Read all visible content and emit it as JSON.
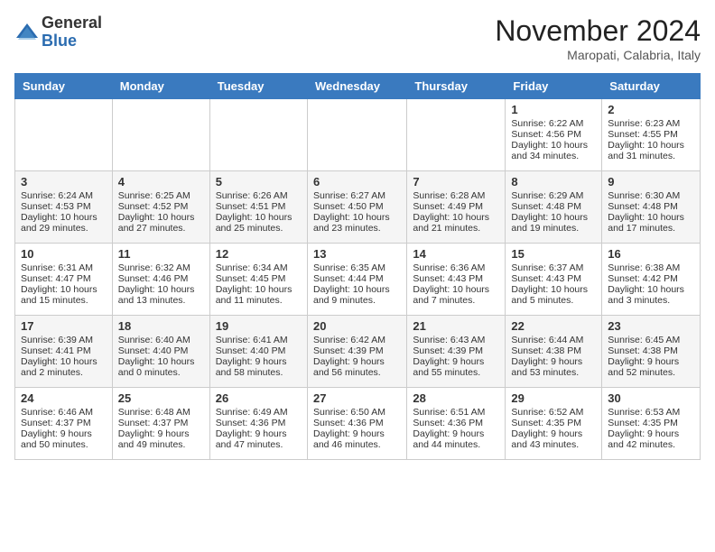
{
  "header": {
    "logo_general": "General",
    "logo_blue": "Blue",
    "month_title": "November 2024",
    "subtitle": "Maropati, Calabria, Italy"
  },
  "days_of_week": [
    "Sunday",
    "Monday",
    "Tuesday",
    "Wednesday",
    "Thursday",
    "Friday",
    "Saturday"
  ],
  "weeks": [
    [
      {
        "day": "",
        "info": ""
      },
      {
        "day": "",
        "info": ""
      },
      {
        "day": "",
        "info": ""
      },
      {
        "day": "",
        "info": ""
      },
      {
        "day": "",
        "info": ""
      },
      {
        "day": "1",
        "info": "Sunrise: 6:22 AM\nSunset: 4:56 PM\nDaylight: 10 hours and 34 minutes."
      },
      {
        "day": "2",
        "info": "Sunrise: 6:23 AM\nSunset: 4:55 PM\nDaylight: 10 hours and 31 minutes."
      }
    ],
    [
      {
        "day": "3",
        "info": "Sunrise: 6:24 AM\nSunset: 4:53 PM\nDaylight: 10 hours and 29 minutes."
      },
      {
        "day": "4",
        "info": "Sunrise: 6:25 AM\nSunset: 4:52 PM\nDaylight: 10 hours and 27 minutes."
      },
      {
        "day": "5",
        "info": "Sunrise: 6:26 AM\nSunset: 4:51 PM\nDaylight: 10 hours and 25 minutes."
      },
      {
        "day": "6",
        "info": "Sunrise: 6:27 AM\nSunset: 4:50 PM\nDaylight: 10 hours and 23 minutes."
      },
      {
        "day": "7",
        "info": "Sunrise: 6:28 AM\nSunset: 4:49 PM\nDaylight: 10 hours and 21 minutes."
      },
      {
        "day": "8",
        "info": "Sunrise: 6:29 AM\nSunset: 4:48 PM\nDaylight: 10 hours and 19 minutes."
      },
      {
        "day": "9",
        "info": "Sunrise: 6:30 AM\nSunset: 4:48 PM\nDaylight: 10 hours and 17 minutes."
      }
    ],
    [
      {
        "day": "10",
        "info": "Sunrise: 6:31 AM\nSunset: 4:47 PM\nDaylight: 10 hours and 15 minutes."
      },
      {
        "day": "11",
        "info": "Sunrise: 6:32 AM\nSunset: 4:46 PM\nDaylight: 10 hours and 13 minutes."
      },
      {
        "day": "12",
        "info": "Sunrise: 6:34 AM\nSunset: 4:45 PM\nDaylight: 10 hours and 11 minutes."
      },
      {
        "day": "13",
        "info": "Sunrise: 6:35 AM\nSunset: 4:44 PM\nDaylight: 10 hours and 9 minutes."
      },
      {
        "day": "14",
        "info": "Sunrise: 6:36 AM\nSunset: 4:43 PM\nDaylight: 10 hours and 7 minutes."
      },
      {
        "day": "15",
        "info": "Sunrise: 6:37 AM\nSunset: 4:43 PM\nDaylight: 10 hours and 5 minutes."
      },
      {
        "day": "16",
        "info": "Sunrise: 6:38 AM\nSunset: 4:42 PM\nDaylight: 10 hours and 3 minutes."
      }
    ],
    [
      {
        "day": "17",
        "info": "Sunrise: 6:39 AM\nSunset: 4:41 PM\nDaylight: 10 hours and 2 minutes."
      },
      {
        "day": "18",
        "info": "Sunrise: 6:40 AM\nSunset: 4:40 PM\nDaylight: 10 hours and 0 minutes."
      },
      {
        "day": "19",
        "info": "Sunrise: 6:41 AM\nSunset: 4:40 PM\nDaylight: 9 hours and 58 minutes."
      },
      {
        "day": "20",
        "info": "Sunrise: 6:42 AM\nSunset: 4:39 PM\nDaylight: 9 hours and 56 minutes."
      },
      {
        "day": "21",
        "info": "Sunrise: 6:43 AM\nSunset: 4:39 PM\nDaylight: 9 hours and 55 minutes."
      },
      {
        "day": "22",
        "info": "Sunrise: 6:44 AM\nSunset: 4:38 PM\nDaylight: 9 hours and 53 minutes."
      },
      {
        "day": "23",
        "info": "Sunrise: 6:45 AM\nSunset: 4:38 PM\nDaylight: 9 hours and 52 minutes."
      }
    ],
    [
      {
        "day": "24",
        "info": "Sunrise: 6:46 AM\nSunset: 4:37 PM\nDaylight: 9 hours and 50 minutes."
      },
      {
        "day": "25",
        "info": "Sunrise: 6:48 AM\nSunset: 4:37 PM\nDaylight: 9 hours and 49 minutes."
      },
      {
        "day": "26",
        "info": "Sunrise: 6:49 AM\nSunset: 4:36 PM\nDaylight: 9 hours and 47 minutes."
      },
      {
        "day": "27",
        "info": "Sunrise: 6:50 AM\nSunset: 4:36 PM\nDaylight: 9 hours and 46 minutes."
      },
      {
        "day": "28",
        "info": "Sunrise: 6:51 AM\nSunset: 4:36 PM\nDaylight: 9 hours and 44 minutes."
      },
      {
        "day": "29",
        "info": "Sunrise: 6:52 AM\nSunset: 4:35 PM\nDaylight: 9 hours and 43 minutes."
      },
      {
        "day": "30",
        "info": "Sunrise: 6:53 AM\nSunset: 4:35 PM\nDaylight: 9 hours and 42 minutes."
      }
    ]
  ]
}
